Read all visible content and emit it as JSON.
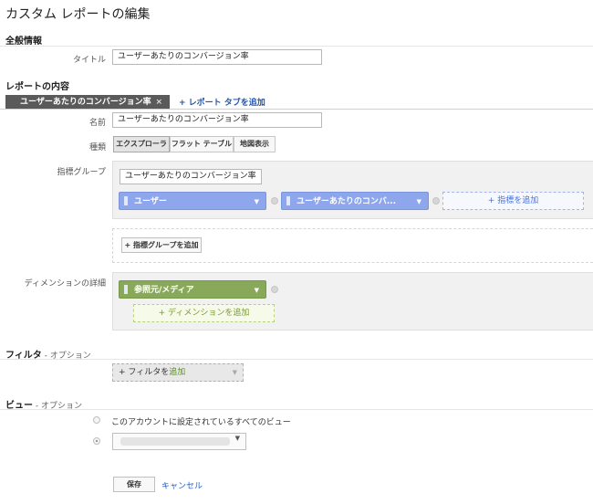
{
  "page": {
    "title": "カスタム レポートの編集"
  },
  "general": {
    "heading": "全般情報",
    "title_label": "タイトル",
    "title_value": "ユーザーあたりのコンバージョン率"
  },
  "content": {
    "heading": "レポートの内容",
    "tab_label": "ユーザーあたりのコンバージョン率",
    "tab_close": "×",
    "add_tab": "+ レポート タブを追加",
    "name_label": "名前",
    "name_value": "ユーザーあたりのコンバージョン率",
    "type_label": "種類",
    "types": [
      "エクスプローラ",
      "フラット テーブル",
      "地図表示"
    ],
    "metric_group_label": "指標グループ",
    "metric_group_name": "ユーザーあたりのコンバージョン率",
    "metrics": [
      "ユーザー",
      "ユーザーあたりのコンバ..."
    ],
    "add_metric": "+ 指標を追加",
    "add_metric_group": "+ 指標グループを追加",
    "dimension_label": "ディメンションの詳細",
    "dimension": "参照元/メディア",
    "add_dimension": "+ ディメンションを追加"
  },
  "filter": {
    "heading": "フィルタ",
    "optional": " - オプション",
    "add_prefix": "+ フィルタを",
    "add_link": "追加"
  },
  "view": {
    "heading": "ビュー",
    "optional": " - オプション",
    "all_views": "このアカウントに設定されているすべてのビュー"
  },
  "actions": {
    "save": "保存",
    "cancel": "キャンセル"
  },
  "colors": {
    "metric_chip": "#8ea7ec",
    "dimension_chip": "#89a95a",
    "link": "#2255aa",
    "tab_bg": "#5a5a5a"
  }
}
